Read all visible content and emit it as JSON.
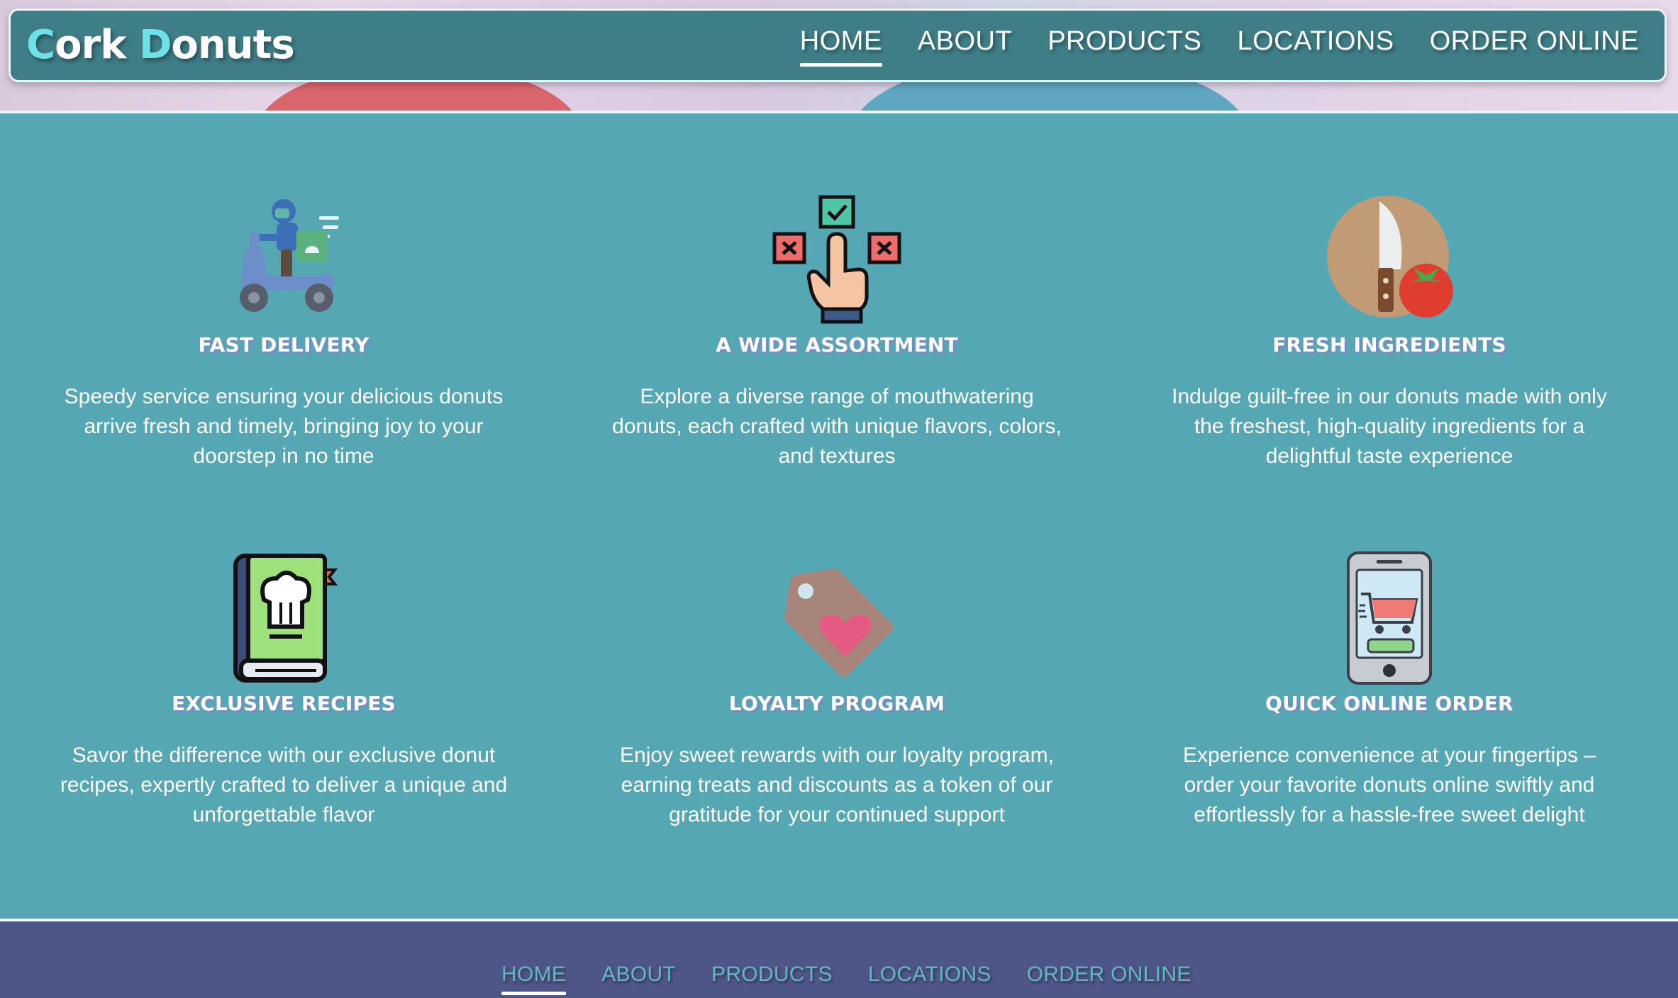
{
  "brand": {
    "name_part1_cap": "C",
    "name_part1_rest": "ork ",
    "name_part2_cap": "D",
    "name_part2_rest": "onuts",
    "accent_color": "#6fe0e6"
  },
  "header": {
    "nav": [
      {
        "label": "HOME",
        "active": true
      },
      {
        "label": "ABOUT",
        "active": false
      },
      {
        "label": "PRODUCTS",
        "active": false
      },
      {
        "label": "LOCATIONS",
        "active": false
      },
      {
        "label": "ORDER ONLINE",
        "active": false
      }
    ]
  },
  "features": [
    {
      "icon": "delivery-scooter-icon",
      "title": "FAST DELIVERY",
      "description": "Speedy service ensuring your delicious donuts arrive fresh and timely, bringing joy to your doorstep in no time"
    },
    {
      "icon": "choice-hand-icon",
      "title": "A WIDE ASSORTMENT",
      "description": "Explore a diverse range of mouthwatering donuts, each crafted with unique flavors, colors, and textures"
    },
    {
      "icon": "knife-tomato-icon",
      "title": "FRESH INGREDIENTS",
      "description": "Indulge guilt-free in our donuts made with only the freshest, high-quality ingredients for a delightful taste experience"
    },
    {
      "icon": "recipe-book-icon",
      "title": "EXCLUSIVE RECIPES",
      "description": "Savor the difference with our exclusive donut recipes, expertly crafted to deliver a unique and unforgettable flavor"
    },
    {
      "icon": "heart-tag-icon",
      "title": "LOYALTY PROGRAM",
      "description": "Enjoy sweet rewards with our loyalty program, earning treats and discounts as a token of our gratitude for your continued support"
    },
    {
      "icon": "phone-cart-icon",
      "title": "QUICK ONLINE ORDER",
      "description": "Experience convenience at your fingertips – order your favorite donuts online swiftly and effortlessly for a hassle-free sweet delight"
    }
  ],
  "footer": {
    "nav": [
      {
        "label": "HOME",
        "active": true
      },
      {
        "label": "ABOUT",
        "active": false
      },
      {
        "label": "PRODUCTS",
        "active": false
      },
      {
        "label": "LOCATIONS",
        "active": false
      },
      {
        "label": "ORDER ONLINE",
        "active": false
      }
    ]
  },
  "colors": {
    "section_bg": "#55a8b3",
    "header_bg": "#3f7e87",
    "footer_bg": "#4e5587",
    "footer_link": "#63b6c2"
  }
}
